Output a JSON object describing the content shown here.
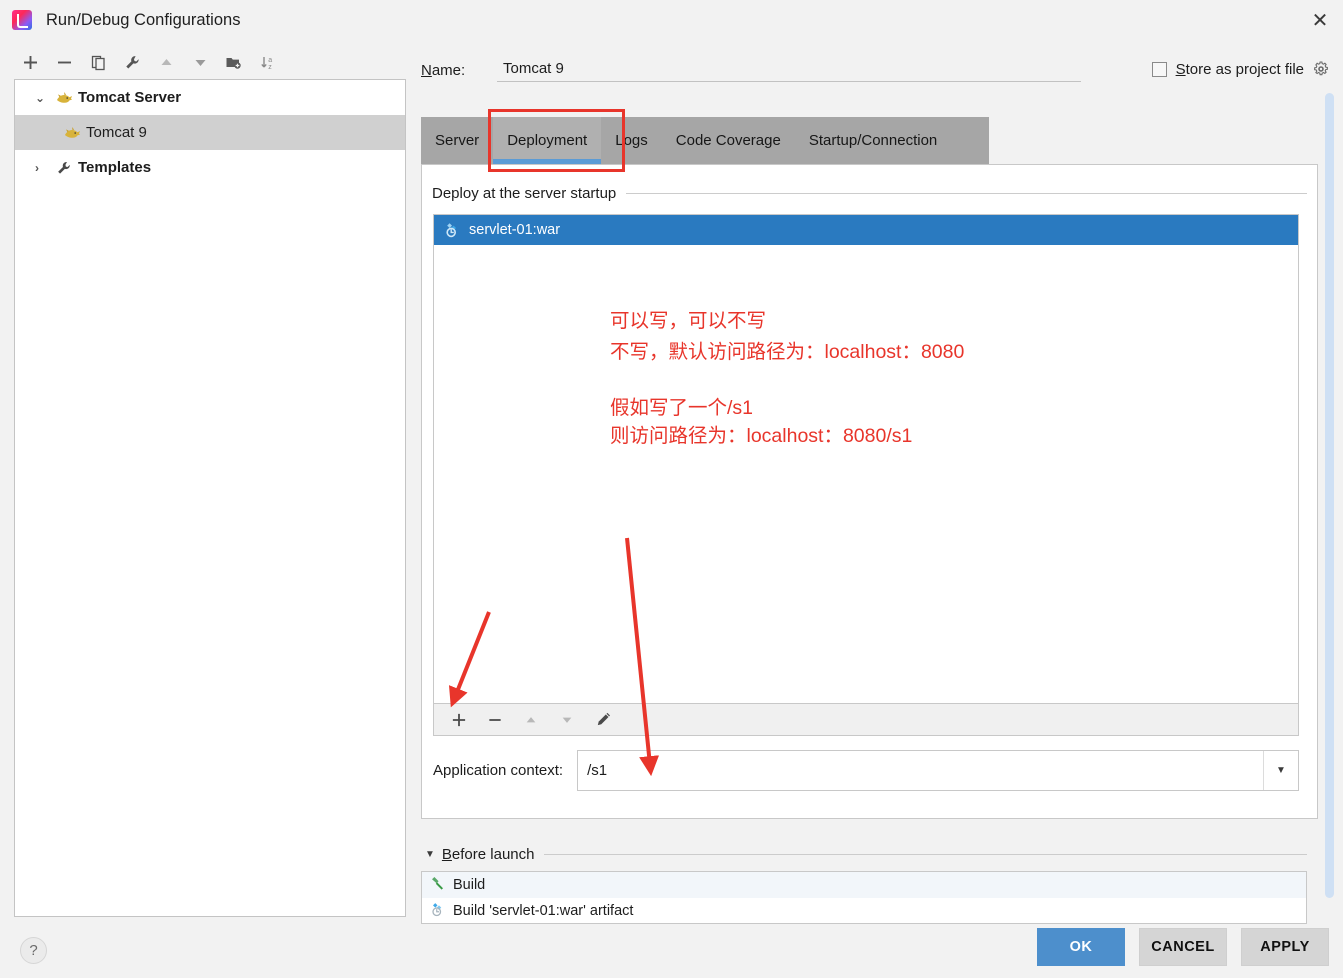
{
  "window": {
    "title": "Run/Debug Configurations",
    "app_icon": "intellij-idea-icon",
    "close_label": "✕"
  },
  "left_toolbar": {
    "buttons": [
      {
        "name": "add-configuration-button",
        "icon": "plus-icon",
        "label": "+"
      },
      {
        "name": "remove-configuration-button",
        "icon": "minus-icon",
        "label": "−"
      },
      {
        "name": "copy-configuration-button",
        "icon": "copy-icon",
        "label": ""
      },
      {
        "name": "edit-templates-button",
        "icon": "wrench-icon",
        "label": ""
      },
      {
        "name": "move-up-button",
        "icon": "triangle-up-icon",
        "label": ""
      },
      {
        "name": "move-down-button",
        "icon": "triangle-down-icon",
        "label": ""
      },
      {
        "name": "move-into-folder-button",
        "icon": "folder-add-icon",
        "label": ""
      },
      {
        "name": "sort-alphabetically-button",
        "icon": "sort-az-icon",
        "label": ""
      }
    ]
  },
  "tree": {
    "items": [
      {
        "label": "Tomcat Server",
        "icon": "tomcat-cat-icon",
        "twisty": "⌄",
        "level": 0,
        "selected": false,
        "bold": true
      },
      {
        "label": "Tomcat 9",
        "icon": "tomcat-cat-icon",
        "twisty": "",
        "level": 1,
        "selected": true,
        "bold": false
      },
      {
        "label": "Templates",
        "icon": "wrench-icon",
        "twisty": "›",
        "level": 0,
        "selected": false,
        "bold": true
      }
    ]
  },
  "name_field": {
    "label_prefix": "N",
    "label_rest": "ame:",
    "value": "Tomcat 9",
    "placeholder": "Name"
  },
  "store_as_project_file": {
    "checked": false,
    "label_prefix": "S",
    "label_rest": "tore as project file",
    "gear_icon": "gear-icon"
  },
  "tabs": [
    {
      "label": "Server",
      "active": false
    },
    {
      "label": "Deployment",
      "active": true
    },
    {
      "label": "Logs",
      "active": false
    },
    {
      "label": "Code Coverage",
      "active": false
    },
    {
      "label": "Startup/Connection",
      "active": false
    }
  ],
  "deployment": {
    "section_caption": "Deploy at the server startup",
    "items": [
      {
        "label": "servlet-01:war",
        "icon": "artifact-icon",
        "selected": true
      }
    ],
    "list_toolbar": [
      {
        "name": "add-artifact-button",
        "icon": "plus-icon"
      },
      {
        "name": "remove-artifact-button",
        "icon": "minus-icon"
      },
      {
        "name": "move-artifact-up-button",
        "icon": "triangle-up-icon"
      },
      {
        "name": "move-artifact-down-button",
        "icon": "triangle-down-icon"
      },
      {
        "name": "edit-artifact-button",
        "icon": "pencil-icon"
      }
    ],
    "application_context": {
      "label": "Application context:",
      "value": "/s1",
      "placeholder": ""
    }
  },
  "before_launch": {
    "caption_prefix": "B",
    "caption_rest": "efore launch",
    "items": [
      {
        "label": "Build",
        "icon": "hammer-icon"
      },
      {
        "label": "Build 'servlet-01:war' artifact",
        "icon": "artifact-icon"
      }
    ]
  },
  "footer": {
    "help_label": "?",
    "ok_label": "OK",
    "cancel_label": "CANCEL",
    "apply_label": "APPLY"
  },
  "annotations": {
    "color": "#e8352b",
    "note_1_line_1": "可以写，可以不写",
    "note_1_line_2": "不写，默认访问路径为：localhost：8080",
    "note_2_line_1": "假如写了一个/s1",
    "note_2_line_2": "则访问路径为：localhost：8080/s1",
    "highlight_target": "Deployment",
    "arrow_1_target": "add-artifact-button",
    "arrow_2_target": "application-context-input"
  }
}
